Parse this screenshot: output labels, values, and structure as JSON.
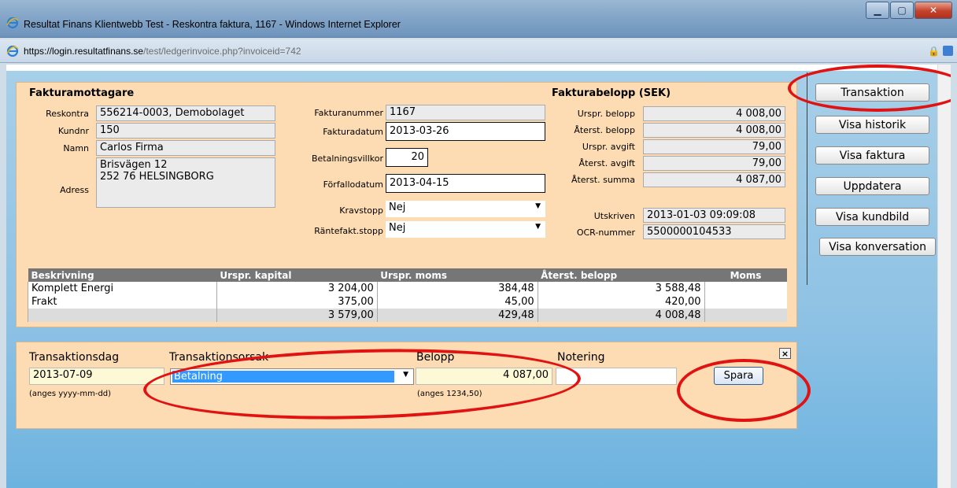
{
  "window": {
    "title": "Resultat Finans Klientwebb Test - Reskontra faktura, 1167 - Windows Internet Explorer",
    "url_prefix": "https://login.",
    "url_domain": "resultatfinans.se",
    "url_path": "/test/ledgerinvoice.php?invoiceid=742"
  },
  "recipient": {
    "heading": "Fakturamottagare",
    "reskontra_label": "Reskontra",
    "reskontra_value": "556214-0003, Demobolaget",
    "kundnr_label": "Kundnr",
    "kundnr_value": "150",
    "namn_label": "Namn",
    "namn_value": "Carlos Firma",
    "adress_label": "Adress",
    "adress_line1": "Brisvägen 12",
    "adress_line2": "252 76 HELSINGBORG"
  },
  "invoice": {
    "fakturanummer_label": "Fakturanummer",
    "fakturanummer_value": "1167",
    "fakturadatum_label": "Fakturadatum",
    "fakturadatum_value": "2013-03-26",
    "betalningsvillkor_label": "Betalningsvillkor",
    "betalningsvillkor_value": "20",
    "forfallodatum_label": "Förfallodatum",
    "forfallodatum_value": "2013-04-15",
    "kravstopp_label": "Kravstopp",
    "kravstopp_value": "Nej",
    "rantefakt_label": "Räntefakt.stopp",
    "rantefakt_value": "Nej"
  },
  "amounts": {
    "heading": "Fakturabelopp (SEK)",
    "urspr_belopp_label": "Urspr. belopp",
    "urspr_belopp_value": "4 008,00",
    "aterst_belopp_label": "Återst. belopp",
    "aterst_belopp_value": "4 008,00",
    "urspr_avgift_label": "Urspr. avgift",
    "urspr_avgift_value": "79,00",
    "aterst_avgift_label": "Återst. avgift",
    "aterst_avgift_value": "79,00",
    "aterst_summa_label": "Återst. summa",
    "aterst_summa_value": "4 087,00",
    "utskriven_label": "Utskriven",
    "utskriven_value": "2013-01-03 09:09:08",
    "ocr_label": "OCR-nummer",
    "ocr_value": "5500000104533"
  },
  "table": {
    "headers": [
      "Beskrivning",
      "Urspr. kapital",
      "Urspr. moms",
      "Återst. belopp",
      "Moms"
    ],
    "rows": [
      [
        "Komplett Energi",
        "3 204,00",
        "384,48",
        "3 588,48",
        ""
      ],
      [
        "Frakt",
        "375,00",
        "45,00",
        "420,00",
        ""
      ]
    ],
    "total": [
      "",
      "3 579,00",
      "429,48",
      "4 008,48",
      ""
    ]
  },
  "transaction": {
    "date_label": "Transaktionsdag",
    "date_value": "2013-07-09",
    "date_hint": "(anges yyyy-mm-dd)",
    "cause_label": "Transaktionsorsak",
    "cause_value": "Betalning",
    "amount_label": "Belopp",
    "amount_value": "4 087,00",
    "amount_hint": "(anges 1234,50)",
    "note_label": "Notering",
    "note_value": "",
    "save_label": "Spara",
    "close_label": "×"
  },
  "side_buttons": {
    "transaktion": "Transaktion",
    "visa_historik": "Visa historik",
    "visa_faktura": "Visa faktura",
    "uppdatera": "Uppdatera",
    "visa_kundbild": "Visa kundbild",
    "visa_konversation": "Visa konversation"
  },
  "colors": {
    "panel_bg": "#fddcb4",
    "table_header": "#767676",
    "selected_option": "#3399ff",
    "annotation_red": "#e01212"
  }
}
